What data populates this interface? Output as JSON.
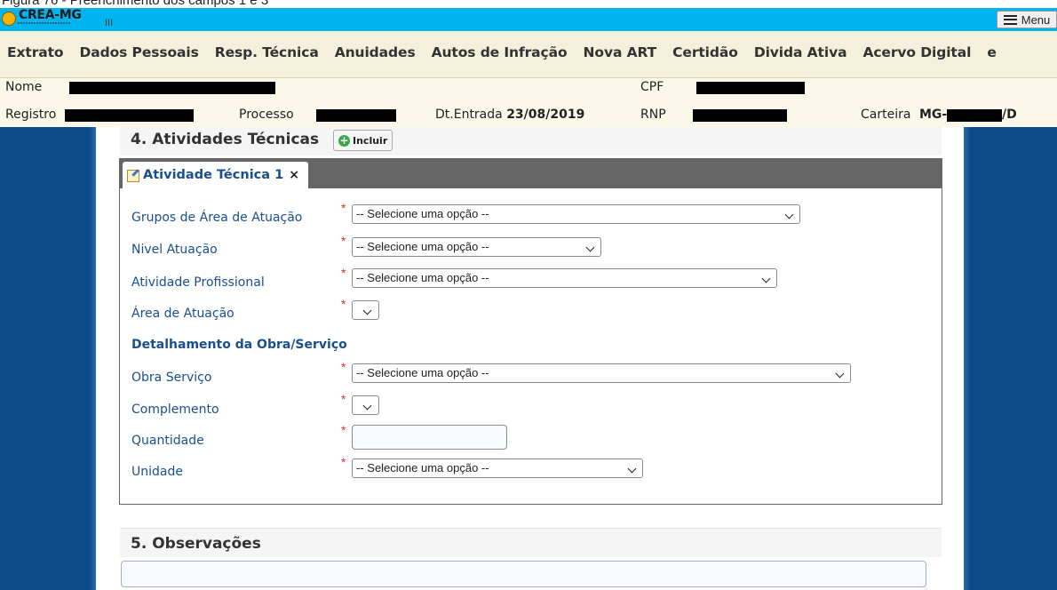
{
  "caption": "Figura 76 - Preenchimento dos campos 1 e 3",
  "header": {
    "logo_text": "CREA-MG",
    "logo_bars": "III",
    "menu_label": "Menu"
  },
  "nav": {
    "items": [
      "Extrato",
      "Dados Pessoais",
      "Resp. Técnica",
      "Anuidades",
      "Autos de Infração",
      "Nova ART",
      "Certidão",
      "Divida Ativa",
      "Acervo Digital",
      "e"
    ]
  },
  "info": {
    "nome_label": "Nome",
    "cpf_label": "CPF",
    "registro_label": "Registro",
    "processo_label": "Processo",
    "dt_entrada_label": "Dt.Entrada",
    "dt_entrada_value": "23/08/2019",
    "rnp_label": "RNP",
    "carteira_label": "Carteira",
    "carteira_prefix": "MG-",
    "carteira_suffix": "/D"
  },
  "section4": {
    "title": "4. Atividades Técnicas",
    "incluir_label": "Incluir",
    "tab_label": "Atividade Técnica 1",
    "tab_close": "×",
    "fields": {
      "grupos_label": "Grupos de Área de Atuação",
      "grupos_value": "-- Selecione uma opção --",
      "nivel_label": "Nivel Atuação",
      "nivel_value": "-- Selecione uma opção --",
      "atividade_label": "Atividade Profissional",
      "atividade_value": "-- Selecione uma opção --",
      "area_label": "Área de Atuação",
      "detalhamento_label": "Detalhamento da Obra/Serviço",
      "obra_label": "Obra Serviço",
      "obra_value": "-- Selecione uma opção --",
      "complemento_label": "Complemento",
      "quantidade_label": "Quantidade",
      "quantidade_value": "",
      "unidade_label": "Unidade",
      "unidade_value": "-- Selecione uma opção --"
    },
    "required_mark": "*"
  },
  "section5": {
    "title": "5. Observações",
    "obs_value": ""
  }
}
